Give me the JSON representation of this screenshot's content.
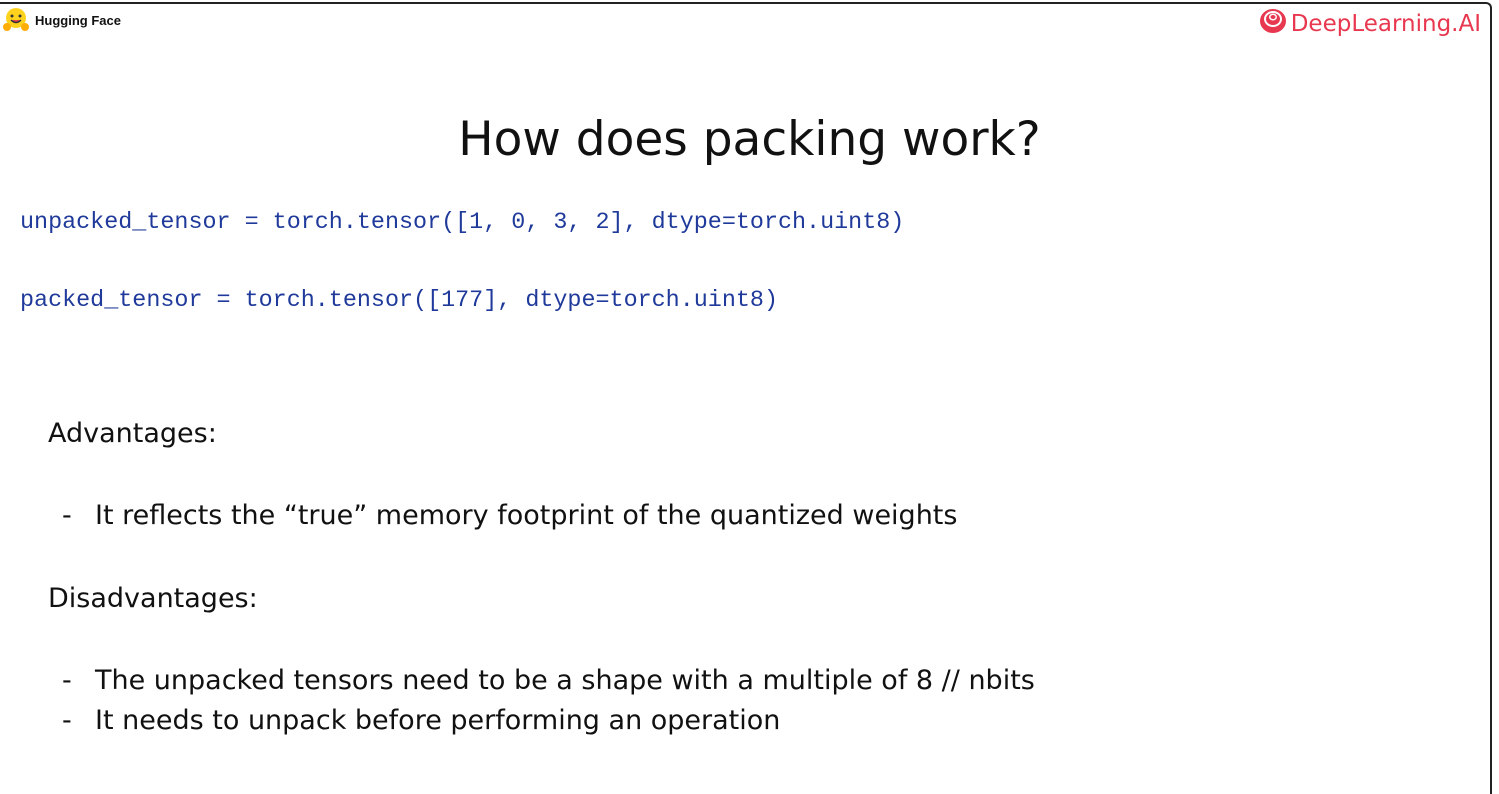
{
  "header": {
    "left_brand": "Hugging Face",
    "right_brand": "DeepLearning.AI",
    "brand_color": "#e8384f"
  },
  "slide": {
    "title": "How does packing work?",
    "code": [
      "unpacked_tensor = torch.tensor([1, 0, 3, 2], dtype=torch.uint8)",
      "packed_tensor = torch.tensor([177], dtype=torch.uint8)"
    ],
    "advantages_heading": "Advantages:",
    "advantages": [
      "It reflects the “true” memory footprint of the quantized weights"
    ],
    "disadvantages_heading": "Disadvantages:",
    "disadvantages": [
      "The unpacked tensors need to be a shape with a multiple of 8 // nbits",
      "It needs to unpack before performing an operation"
    ],
    "bullet": "-"
  }
}
